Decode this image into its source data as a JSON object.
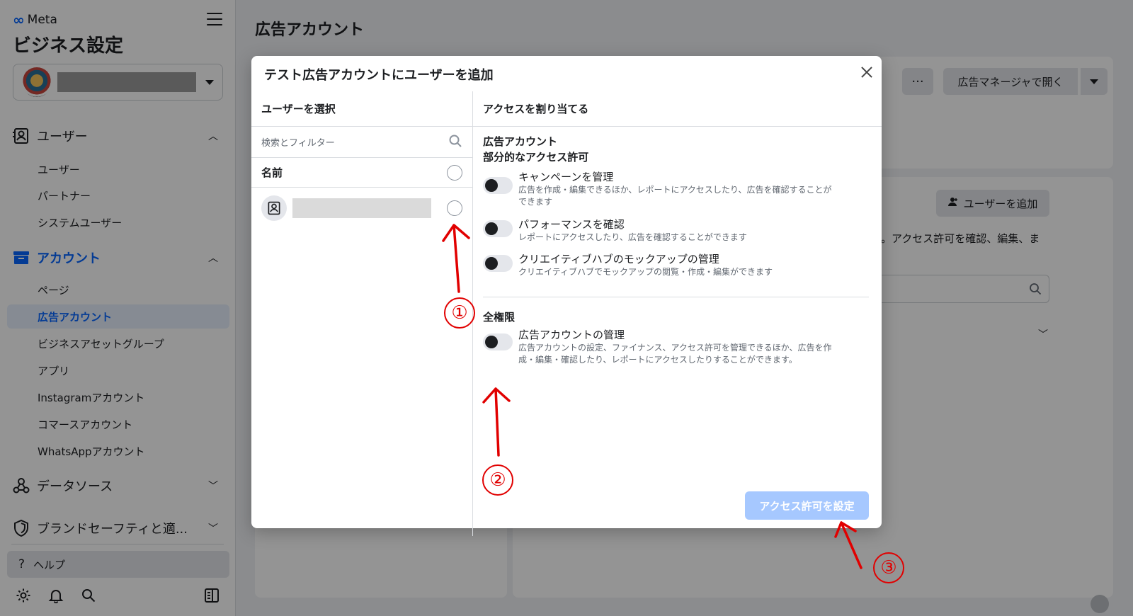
{
  "sidebar": {
    "brand": "Meta",
    "title": "ビジネス設定",
    "sections": {
      "users": {
        "label": "ユーザー",
        "items": [
          "ユーザー",
          "パートナー",
          "システムユーザー"
        ]
      },
      "accounts": {
        "label": "アカウント",
        "items": [
          "ページ",
          "広告アカウント",
          "ビジネスアセットグループ",
          "アプリ",
          "Instagramアカウント",
          "コマースアカウント",
          "WhatsAppアカウント"
        ]
      },
      "data_sources": {
        "label": "データソース"
      },
      "brand_safety": {
        "label": "ブランドセーフティと適..."
      }
    },
    "help": "ヘルプ"
  },
  "main": {
    "title": "広告アカウント",
    "more_button": "···",
    "open_ads_manager": "広告マネージャで開く",
    "add_user_button": "ユーザーを追加",
    "description_fragment": "。アクセス許可を確認、編集、ま"
  },
  "modal": {
    "title": "テスト広告アカウントにユーザーを追加",
    "left_header": "ユーザーを選択",
    "right_header": "アクセスを割り当てる",
    "search_placeholder": "検索とフィルター",
    "name_column": "名前",
    "group1_title": "広告アカウント",
    "group1_subtitle": "部分的なアクセス許可",
    "permissions_partial": [
      {
        "title": "キャンペーンを管理",
        "desc1": "広告を作成・編集できるほか、レポートにアクセスしたり、広告を確認することが",
        "desc2": "できます"
      },
      {
        "title": "パフォーマンスを確認",
        "desc1": "レポートにアクセスしたり、広告を確認することができます",
        "desc2": ""
      },
      {
        "title": "クリエイティブハブのモックアップの管理",
        "desc1": "クリエイティブハブでモックアップの閲覧・作成・編集ができます",
        "desc2": ""
      }
    ],
    "group2_title": "全権限",
    "permissions_full": [
      {
        "title": "広告アカウントの管理",
        "desc1": "広告アカウントの設定、ファイナンス、アクセス許可を管理できるほか、広告を作",
        "desc2": "成・編集・確認したり、レポートにアクセスしたりすることができます。"
      }
    ],
    "submit_button": "アクセス許可を設定"
  },
  "annotations": [
    "①",
    "②",
    "③"
  ],
  "colors": {
    "accent": "#0866ff",
    "annotation": "#e10000",
    "disabled_button": "#a6c8ff"
  }
}
